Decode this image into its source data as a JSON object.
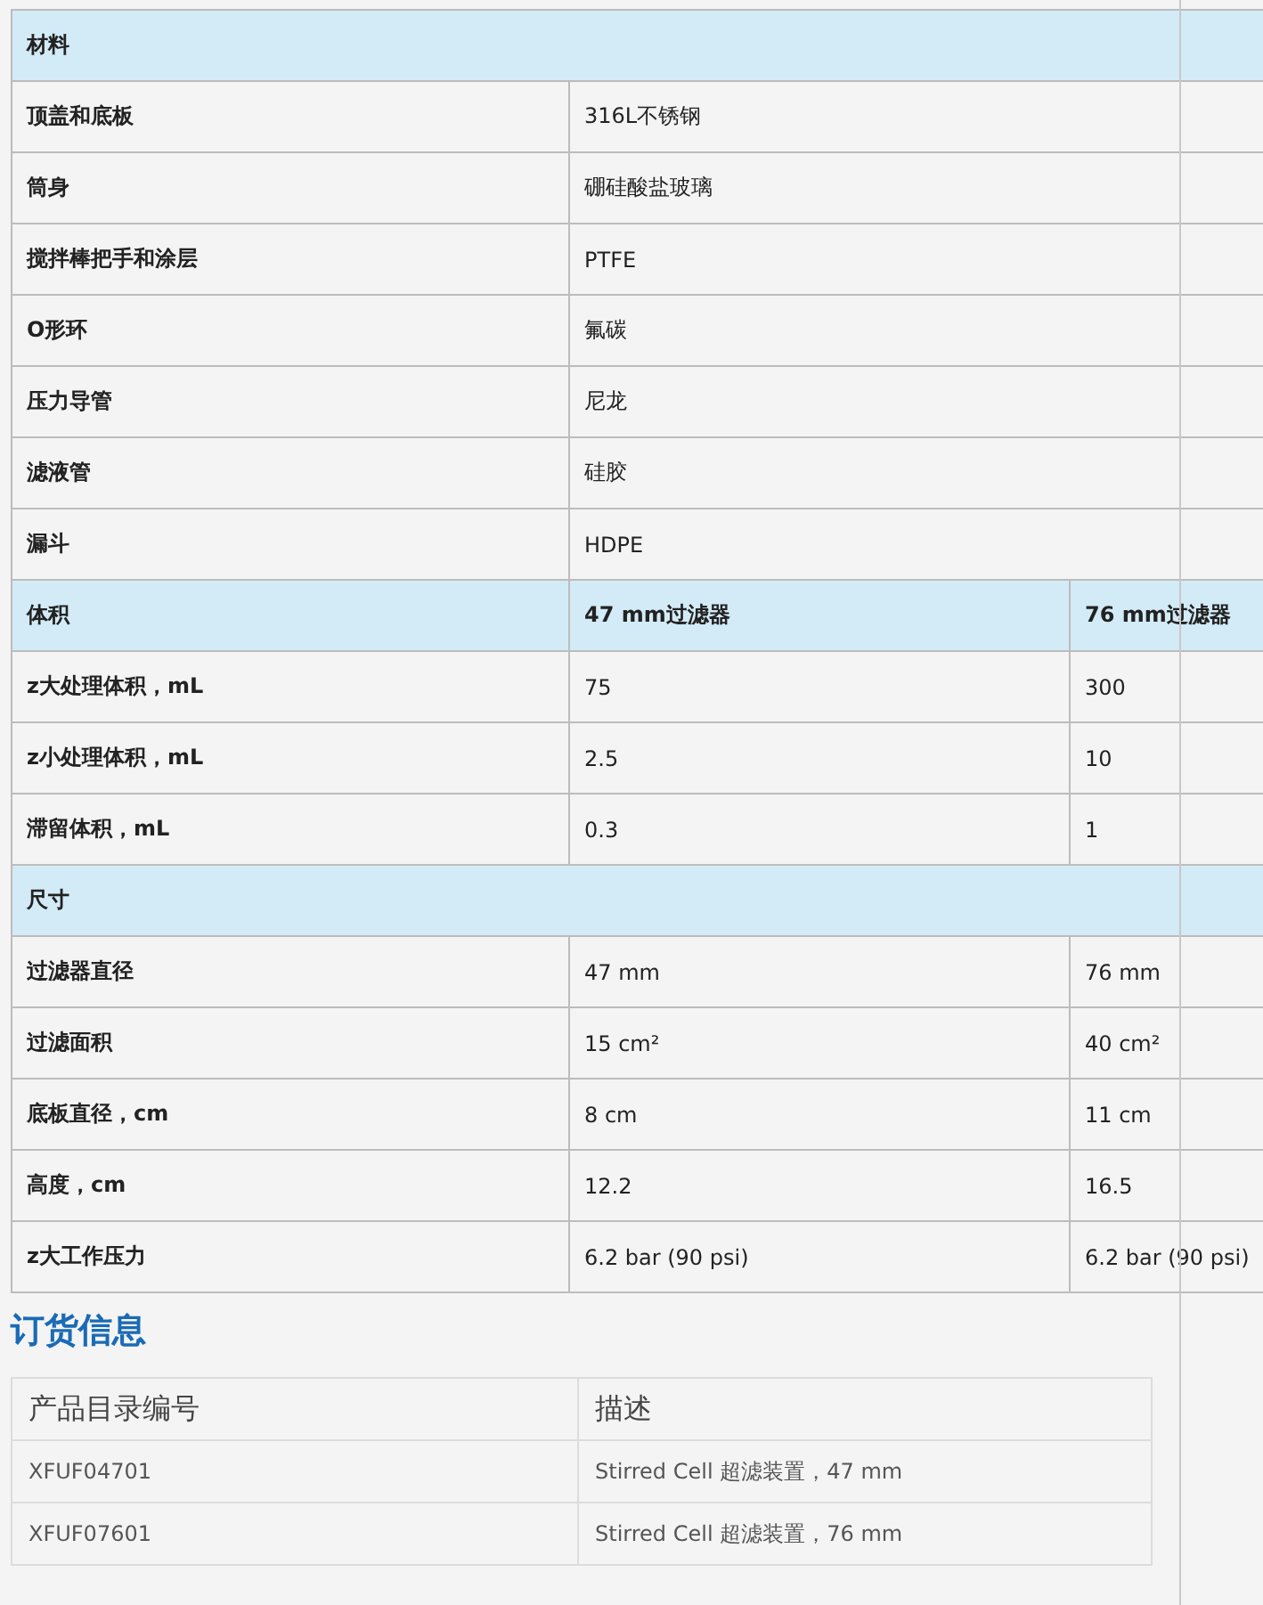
{
  "spec_sections": [
    {
      "headers": [
        "材料"
      ],
      "rows": [
        {
          "label": "顶盖和底板",
          "values": [
            "316L不锈钢"
          ]
        },
        {
          "label": "筒身",
          "values": [
            "硼硅酸盐玻璃"
          ]
        },
        {
          "label": "搅拌棒把手和涂层",
          "values": [
            "PTFE"
          ]
        },
        {
          "label": "O形环",
          "values": [
            "氟碳"
          ]
        },
        {
          "label": "压力导管",
          "values": [
            "尼龙"
          ]
        },
        {
          "label": "滤液管",
          "values": [
            "硅胶"
          ]
        },
        {
          "label": "漏斗",
          "values": [
            "HDPE"
          ]
        }
      ]
    },
    {
      "headers": [
        "体积",
        "47 mm过滤器",
        "76 mm过滤器"
      ],
      "rows": [
        {
          "label": "z大处理体积，mL",
          "values": [
            "75",
            "300"
          ]
        },
        {
          "label": "z小处理体积，mL",
          "values": [
            "2.5",
            "10"
          ]
        },
        {
          "label": "滞留体积，mL",
          "values": [
            "0.3",
            "1"
          ]
        }
      ]
    },
    {
      "headers": [
        "尺寸"
      ],
      "rows": [
        {
          "label": "过滤器直径",
          "values": [
            "47 mm",
            "76 mm"
          ]
        },
        {
          "label": "过滤面积",
          "values": [
            "15 cm²",
            "40 cm²"
          ]
        },
        {
          "label": "底板直径，cm",
          "values": [
            "8 cm",
            "11 cm"
          ]
        },
        {
          "label": "高度，cm",
          "values": [
            "12.2",
            "16.5"
          ]
        },
        {
          "label": "z大工作压力",
          "values": [
            "6.2 bar (90 psi)",
            "6.2 bar (90 psi)"
          ]
        }
      ]
    }
  ],
  "ordering": {
    "title": "订货信息",
    "columns": [
      "产品目录编号",
      "描述"
    ],
    "rows": [
      [
        "XFUF04701",
        "Stirred Cell 超滤装置，47 mm"
      ],
      [
        "XFUF07601",
        "Stirred Cell 超滤装置，76 mm"
      ]
    ]
  }
}
